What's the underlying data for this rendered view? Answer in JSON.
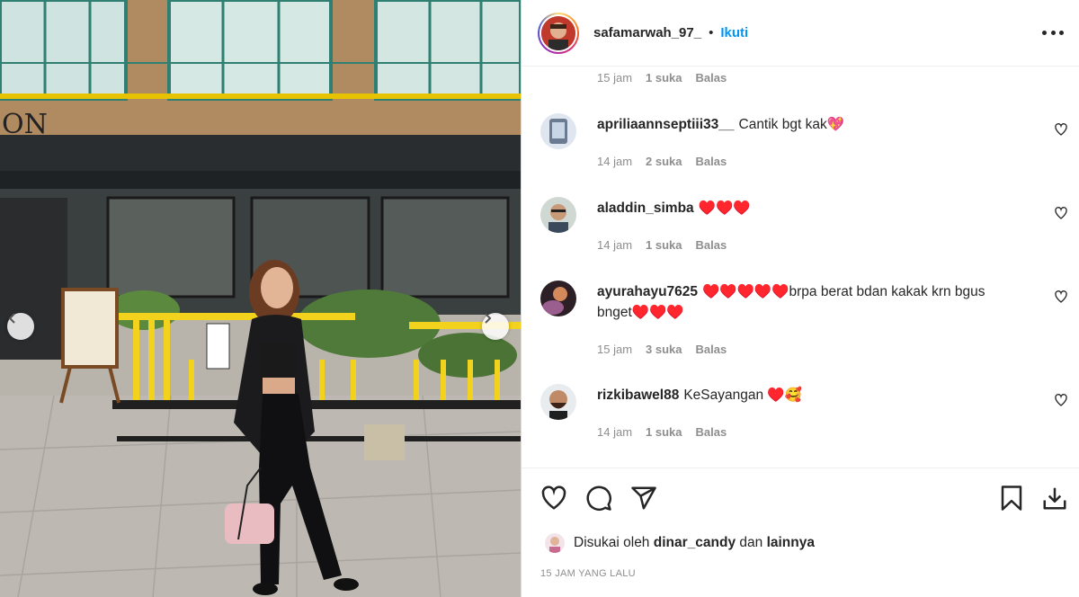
{
  "post": {
    "username": "safamarwah_97_",
    "separator": "•",
    "follow_label": "Ikuti",
    "more_icon": "more-horizontal-icon"
  },
  "first_meta": {
    "time": "15 jam",
    "likes": "1 suka",
    "reply": "Balas"
  },
  "comments": [
    {
      "user": "apriliaannseptiii33__",
      "text": "Cantik bgt kak💖",
      "time": "14 jam",
      "likes": "2 suka",
      "reply": "Balas"
    },
    {
      "user": "aladdin_simba",
      "text": "♥️♥️♥️",
      "time": "14 jam",
      "likes": "1 suka",
      "reply": "Balas"
    },
    {
      "user": "ayurahayu7625",
      "text": "♥️♥️♥️♥️♥️brpa berat bdan kakak krn bgus bnget♥️♥️♥️",
      "time": "15 jam",
      "likes": "3 suka",
      "reply": "Balas"
    },
    {
      "user": "rizkibawel88",
      "text": "KeSayangan ♥️🥰",
      "time": "14 jam",
      "likes": "1 suka",
      "reply": "Balas"
    }
  ],
  "liked_by": {
    "prefix": "Disukai oleh",
    "user": "dinar_candy",
    "conj": "dan",
    "others": "lainnya"
  },
  "timestamp": "15 JAM YANG LALU",
  "colors": {
    "link": "#0095f6",
    "heart_red": "#ed4956",
    "muted": "#8e8e8e"
  }
}
